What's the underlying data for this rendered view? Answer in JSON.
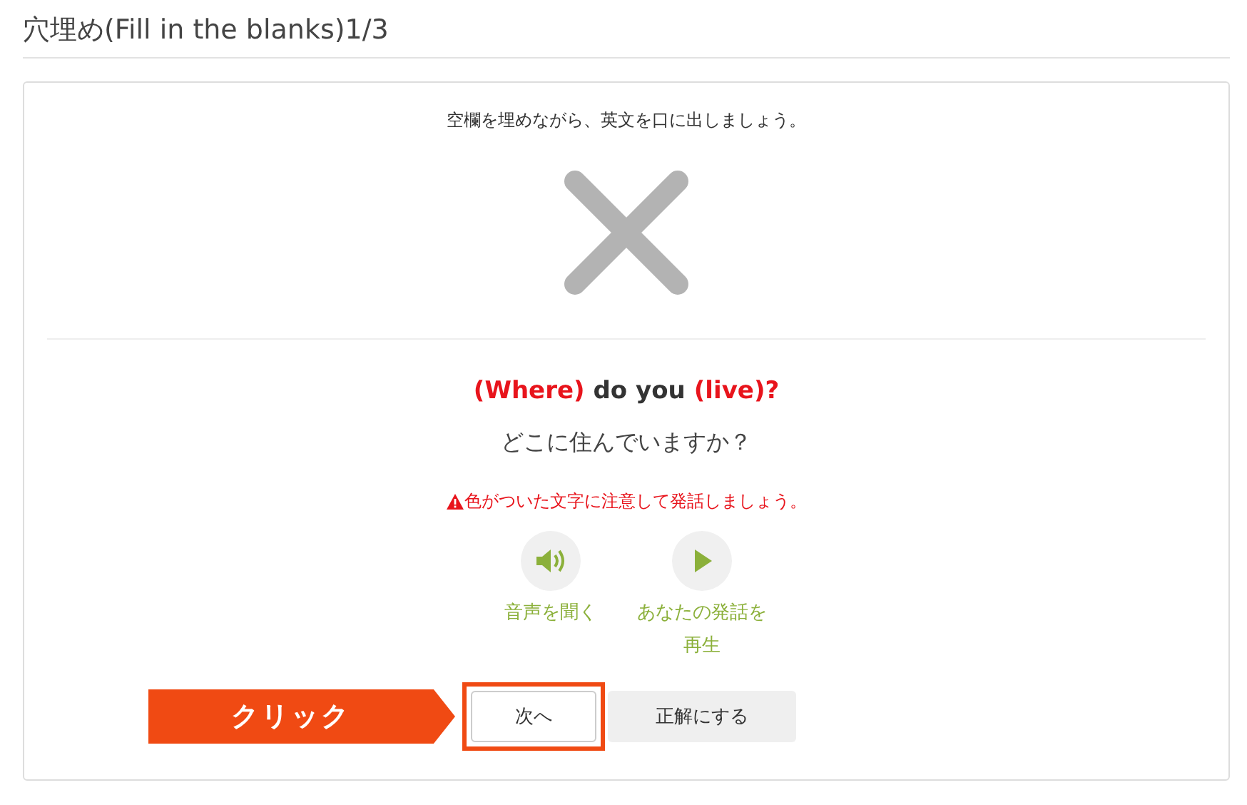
{
  "page_title": "穴埋め(Fill in the blanks)1/3",
  "instruction": "空欄を埋めながら、英文を口に出しましょう。",
  "sentence": [
    {
      "text": "(Where)",
      "highlight": true
    },
    {
      "text": "do you",
      "highlight": false
    },
    {
      "text": "(live)?",
      "highlight": true
    }
  ],
  "translation": "どこに住んでいますか？",
  "warning": "色がついた文字に注意して発話しましょう。",
  "audio_buttons": [
    {
      "kind": "speaker",
      "label": "音声を聞く"
    },
    {
      "kind": "play",
      "label": "あなたの発話を再生"
    }
  ],
  "buttons": [
    {
      "label": "次へ",
      "highlighted": true
    },
    {
      "label": "正解にする",
      "highlighted": false
    }
  ],
  "callout": "クリック"
}
